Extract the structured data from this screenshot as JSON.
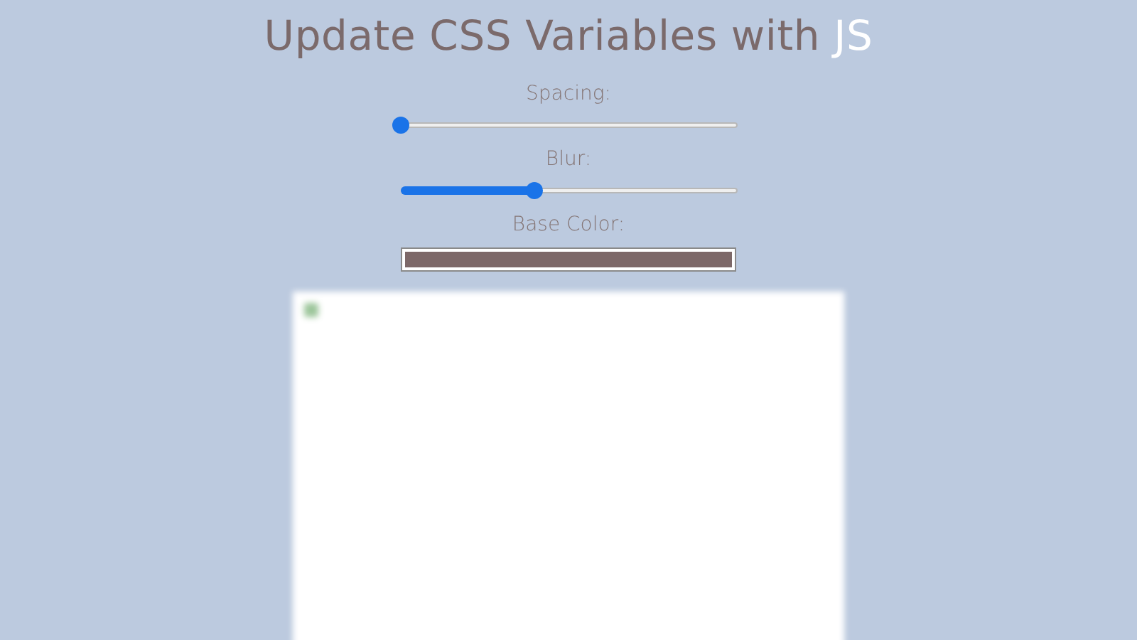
{
  "title": {
    "text": "Update CSS Variables with",
    "highlight": "JS"
  },
  "controls": [
    {
      "kind": "slider",
      "label": "Spacing:",
      "level": 0
    },
    {
      "kind": "slider",
      "label": "Blur:",
      "level": 0.4
    },
    {
      "kind": "color",
      "label": "Base Color:",
      "color": "#7d6868"
    }
  ]
}
